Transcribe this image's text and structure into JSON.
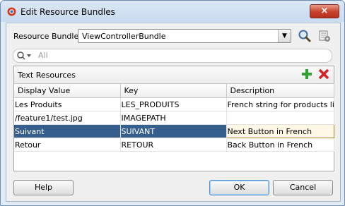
{
  "window": {
    "title": "Edit Resource Bundles",
    "close_label": "×"
  },
  "resource_bundle": {
    "label": "Resource Bundle:",
    "selected": "ViewControllerBundle"
  },
  "filter": {
    "placeholder": "All"
  },
  "text_resources": {
    "title": "Text Resources",
    "columns": [
      "Display Value",
      "Key",
      "Description"
    ],
    "rows": [
      [
        "Les Produits",
        "LES_PRODUITS",
        "French string for products list"
      ],
      [
        "/feature1/test.jpg",
        "IMAGEPATH",
        ""
      ],
      [
        "Suivant",
        "SUIVANT",
        "Next Button in French"
      ],
      [
        "Retour",
        "RETOUR",
        "Back Button in French"
      ]
    ],
    "selected_row": 2
  },
  "buttons": {
    "help": "Help",
    "ok": "OK",
    "cancel": "Cancel"
  },
  "colors": {
    "selection": "#365f8e",
    "add": "#2fa12f",
    "delete": "#d42020"
  },
  "icons": [
    "app-icon",
    "search-icon",
    "manage-bundles-icon",
    "filter-search-icon",
    "add-icon",
    "delete-icon"
  ]
}
